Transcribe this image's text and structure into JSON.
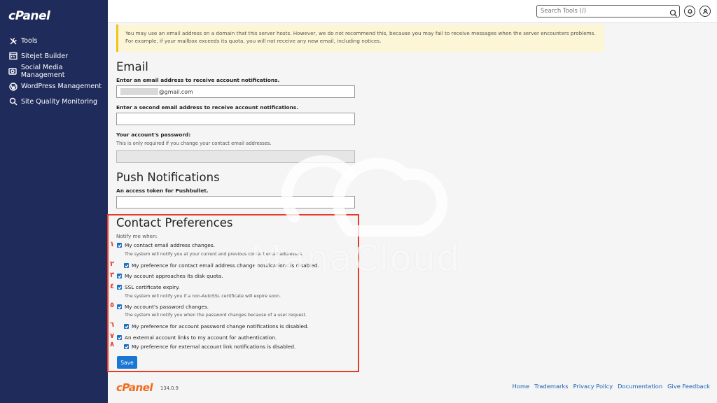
{
  "app": {
    "logo": "cPanel"
  },
  "sidebar": {
    "items": [
      {
        "label": "Tools",
        "icon": "tools-icon"
      },
      {
        "label": "Sitejet Builder",
        "icon": "sitejet-icon"
      },
      {
        "label": "Social Media Management",
        "icon": "social-media-icon"
      },
      {
        "label": "WordPress Management",
        "icon": "wordpress-icon"
      },
      {
        "label": "Site Quality Monitoring",
        "icon": "site-quality-icon"
      }
    ]
  },
  "topbar": {
    "search_placeholder": "Search Tools (/)"
  },
  "notice": {
    "text": "You may use an email address on a domain that this server hosts. However, we do not recommend this, because you may fail to receive messages when the server encounters problems. For example, if your mailbox exceeds its quota, you will not receive any new email, including notices."
  },
  "email": {
    "heading": "Email",
    "label1": "Enter an email address to receive account notifications.",
    "value1": "@gmail.com",
    "label2": "Enter a second email address to receive account notifications.",
    "password_label": "Your account's password:",
    "password_help": "This is only required if you change your contact email addresses."
  },
  "push": {
    "heading": "Push Notifications",
    "label": "An access token for Pushbullet."
  },
  "contact": {
    "heading": "Contact Preferences",
    "intro": "Notify me when:",
    "numbers": [
      "١",
      "٢",
      "٣",
      "٤",
      "٥",
      "٦",
      "٧",
      "٨"
    ],
    "items": [
      {
        "label": "My contact email address changes.",
        "note": "The system will notify you at your current and previous contact email addresses."
      },
      {
        "label": "My preference for contact email address change notifications is disabled."
      },
      {
        "label": "My account approaches its disk quota."
      },
      {
        "label": "SSL certificate expiry.",
        "note": "The system will notify you if a non-AutoSSL certificate will expire soon."
      },
      {
        "label": "My account's password changes.",
        "note": "The system will notify you when the password changes because of a user request."
      },
      {
        "label": "My preference for account password change notifications is disabled."
      },
      {
        "label": "An external account links to my account for authentication."
      },
      {
        "label": "My preference for external account link notifications is disabled."
      }
    ],
    "save_label": "Save"
  },
  "footer": {
    "logo": "cPanel",
    "version": "134.0.9",
    "links": [
      "Home",
      "Trademarks",
      "Privacy Policy",
      "Documentation",
      "Give Feedback"
    ]
  },
  "watermark": {
    "text": "ManaCloud"
  },
  "colors": {
    "sidebar": "#1f2b5a",
    "accent": "#1976d2",
    "highlight": "#e53d2a",
    "brand": "#f26a1b"
  }
}
